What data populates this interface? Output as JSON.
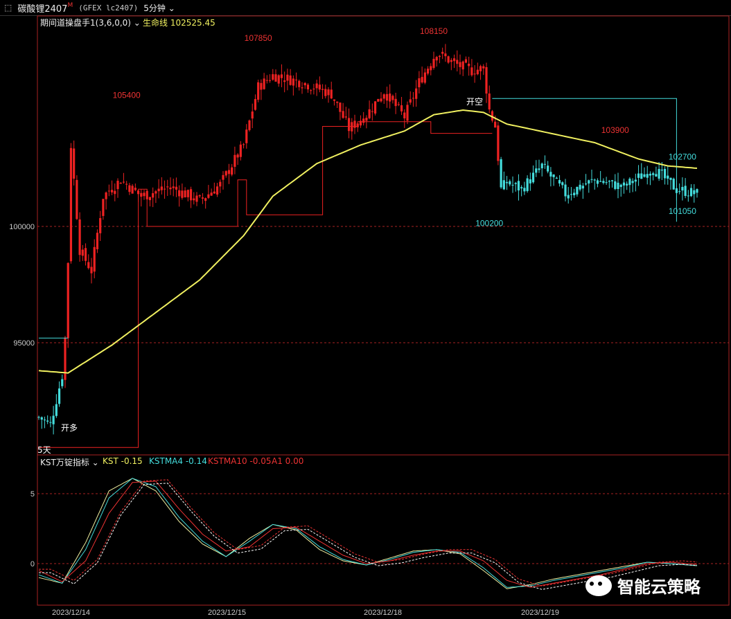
{
  "toolbar": {
    "icon": "window-icon",
    "symbol": "碳酸锂2407",
    "mark": "M",
    "code": "(GFEX lc2407)",
    "period": "5分钟"
  },
  "main_panel": {
    "indicator_name": "期间道操盘手1(3,6,0,0)",
    "lifeline_label": "生命线 102525.45",
    "label_open_long": "开多",
    "label_open_short": "开空",
    "label_5d": "5天"
  },
  "sub_panel": {
    "indicator_name": "KST万锭指标",
    "kst": "KST -0.15",
    "kstma4": "KSTMA4 -0.14",
    "kstma10": "KSTMA10 -0.05",
    "a1": "A1 0.00"
  },
  "watermark": "智能云策略",
  "colors": {
    "up": "#ee2222",
    "down": "#44dddd",
    "lifeline": "#f0f060",
    "grid": "#aa2222",
    "axis_text": "#cccccc"
  },
  "chart_data": [
    {
      "type": "candlestick",
      "title": "碳酸锂2407 5分钟",
      "y_ticks": [
        95000,
        100000
      ],
      "x_ticks": [
        "2023/12/14",
        "2023/12/15",
        "2023/12/18",
        "2023/12/19"
      ],
      "annotations": [
        {
          "text": "105400",
          "value": 105400
        },
        {
          "text": "107850",
          "value": 107850
        },
        {
          "text": "108150",
          "value": 108150
        },
        {
          "text": "103900",
          "value": 103900
        },
        {
          "text": "102700",
          "value": 102700
        },
        {
          "text": "100200",
          "value": 100200
        },
        {
          "text": "101050",
          "value": 101050
        }
      ],
      "lifeline_value": 102525.45,
      "price_path": [
        [
          0,
          91800
        ],
        [
          4,
          91500
        ],
        [
          8,
          93600
        ],
        [
          9,
          95200
        ],
        [
          10,
          98500
        ],
        [
          11,
          103500
        ],
        [
          14,
          99000
        ],
        [
          18,
          98100
        ],
        [
          22,
          101300
        ],
        [
          28,
          102000
        ],
        [
          35,
          101300
        ],
        [
          45,
          101700
        ],
        [
          55,
          101100
        ],
        [
          62,
          101800
        ],
        [
          70,
          103500
        ],
        [
          75,
          106000
        ],
        [
          80,
          106500
        ],
        [
          90,
          106200
        ],
        [
          100,
          105700
        ],
        [
          106,
          104200
        ],
        [
          112,
          104800
        ],
        [
          118,
          105800
        ],
        [
          125,
          104700
        ],
        [
          130,
          106200
        ],
        [
          136,
          107500
        ],
        [
          142,
          107000
        ],
        [
          148,
          106700
        ],
        [
          152,
          106800
        ],
        [
          154,
          105000
        ],
        [
          156,
          104300
        ],
        [
          158,
          101600
        ],
        [
          160,
          101900
        ],
        [
          165,
          101600
        ],
        [
          172,
          102600
        ],
        [
          180,
          101400
        ],
        [
          190,
          102000
        ],
        [
          200,
          101700
        ],
        [
          210,
          102500
        ],
        [
          218,
          101600
        ],
        [
          225,
          101400
        ]
      ],
      "lifeline": [
        [
          0,
          93800
        ],
        [
          10,
          93700
        ],
        [
          25,
          94900
        ],
        [
          40,
          96300
        ],
        [
          55,
          97700
        ],
        [
          70,
          99600
        ],
        [
          80,
          101300
        ],
        [
          95,
          102700
        ],
        [
          110,
          103500
        ],
        [
          125,
          104100
        ],
        [
          135,
          104800
        ],
        [
          145,
          105000
        ],
        [
          152,
          104900
        ],
        [
          160,
          104400
        ],
        [
          175,
          104000
        ],
        [
          190,
          103600
        ],
        [
          205,
          102900
        ],
        [
          215,
          102600
        ],
        [
          225,
          102500
        ]
      ],
      "signal_line_long": [
        [
          0,
          90500
        ],
        [
          34,
          90500
        ],
        [
          34,
          101600
        ],
        [
          37,
          101600
        ],
        [
          37,
          100000
        ],
        [
          68,
          100000
        ],
        [
          68,
          102000
        ],
        [
          71,
          102000
        ],
        [
          71,
          100500
        ],
        [
          97,
          100500
        ],
        [
          97,
          104300
        ],
        [
          109,
          104300
        ],
        [
          109,
          104500
        ],
        [
          134,
          104500
        ],
        [
          134,
          104000
        ],
        [
          155,
          104000
        ]
      ],
      "signal_line_short": [
        [
          155,
          105500
        ],
        [
          218,
          105500
        ],
        [
          218,
          100200
        ]
      ],
      "signal_line_pre": [
        [
          0,
          95200
        ],
        [
          10,
          95200
        ]
      ]
    },
    {
      "type": "line",
      "title": "KST万锭指标",
      "y_ticks": [
        0,
        5
      ],
      "series": [
        {
          "name": "KST",
          "points": [
            [
              0,
              -1.0
            ],
            [
              8,
              -1.4
            ],
            [
              16,
              1.5
            ],
            [
              24,
              5.2
            ],
            [
              32,
              6.1
            ],
            [
              40,
              5.2
            ],
            [
              48,
              3.0
            ],
            [
              56,
              1.4
            ],
            [
              64,
              0.5
            ],
            [
              72,
              1.8
            ],
            [
              80,
              2.8
            ],
            [
              88,
              2.4
            ],
            [
              96,
              1.0
            ],
            [
              104,
              0.2
            ],
            [
              112,
              -0.1
            ],
            [
              120,
              0.4
            ],
            [
              128,
              0.9
            ],
            [
              136,
              1.0
            ],
            [
              144,
              0.7
            ],
            [
              152,
              -0.5
            ],
            [
              160,
              -1.8
            ],
            [
              168,
              -1.5
            ],
            [
              176,
              -1.1
            ],
            [
              184,
              -0.8
            ],
            [
              192,
              -0.5
            ],
            [
              200,
              -0.2
            ],
            [
              208,
              0.1
            ],
            [
              216,
              0.0
            ],
            [
              225,
              -0.15
            ]
          ]
        },
        {
          "name": "KSTMA4",
          "points": [
            [
              0,
              -0.8
            ],
            [
              8,
              -1.4
            ],
            [
              16,
              1.0
            ],
            [
              24,
              4.7
            ],
            [
              32,
              6.1
            ],
            [
              40,
              5.5
            ],
            [
              48,
              3.3
            ],
            [
              56,
              1.6
            ],
            [
              64,
              0.5
            ],
            [
              72,
              1.6
            ],
            [
              80,
              2.8
            ],
            [
              88,
              2.5
            ],
            [
              96,
              1.2
            ],
            [
              104,
              0.3
            ],
            [
              112,
              -0.1
            ],
            [
              120,
              0.3
            ],
            [
              128,
              0.8
            ],
            [
              136,
              1.0
            ],
            [
              144,
              0.8
            ],
            [
              152,
              -0.3
            ],
            [
              160,
              -1.7
            ],
            [
              168,
              -1.6
            ],
            [
              176,
              -1.2
            ],
            [
              184,
              -0.9
            ],
            [
              192,
              -0.6
            ],
            [
              200,
              -0.3
            ],
            [
              208,
              0.1
            ],
            [
              216,
              0.0
            ],
            [
              225,
              -0.14
            ]
          ]
        },
        {
          "name": "KSTMA10",
          "points": [
            [
              0,
              -0.5
            ],
            [
              8,
              -1.3
            ],
            [
              16,
              0.2
            ],
            [
              24,
              3.6
            ],
            [
              32,
              5.8
            ],
            [
              40,
              5.9
            ],
            [
              48,
              3.9
            ],
            [
              56,
              2.1
            ],
            [
              64,
              0.9
            ],
            [
              72,
              1.2
            ],
            [
              80,
              2.5
            ],
            [
              88,
              2.6
            ],
            [
              96,
              1.6
            ],
            [
              104,
              0.6
            ],
            [
              112,
              0.0
            ],
            [
              120,
              0.2
            ],
            [
              128,
              0.6
            ],
            [
              136,
              0.9
            ],
            [
              144,
              0.9
            ],
            [
              152,
              0.2
            ],
            [
              160,
              -1.2
            ],
            [
              168,
              -1.7
            ],
            [
              176,
              -1.4
            ],
            [
              184,
              -1.1
            ],
            [
              192,
              -0.8
            ],
            [
              200,
              -0.4
            ],
            [
              208,
              0.0
            ],
            [
              216,
              0.1
            ],
            [
              225,
              -0.05
            ]
          ]
        }
      ]
    }
  ]
}
